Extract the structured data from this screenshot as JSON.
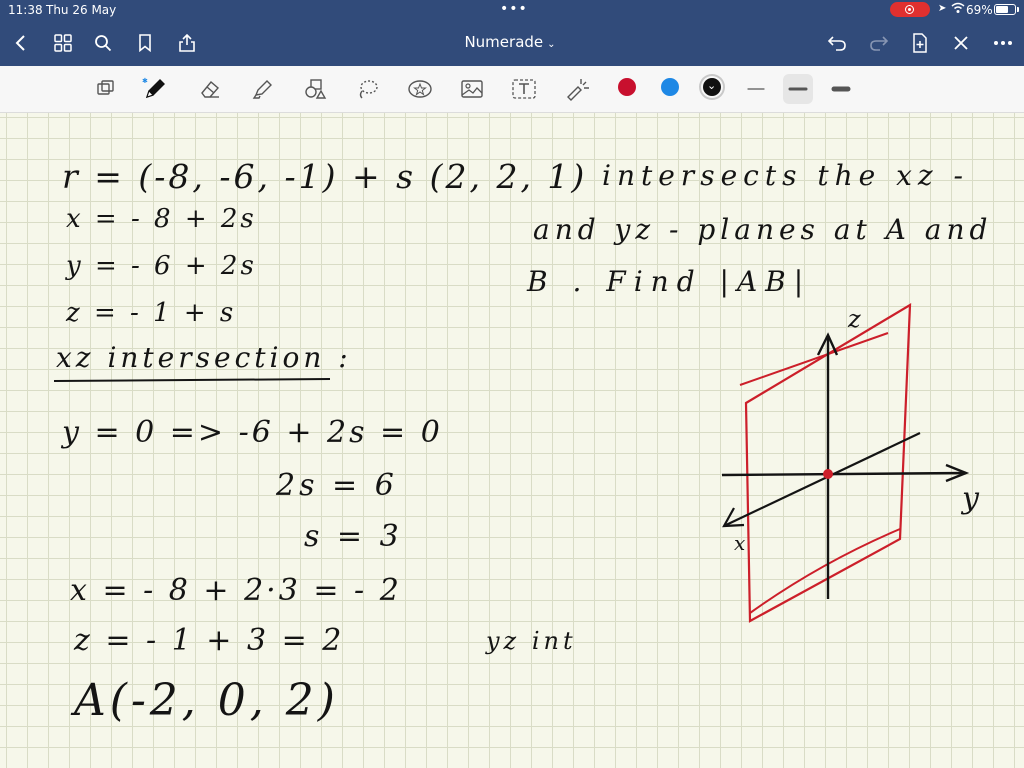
{
  "status_bar": {
    "time": "11:38",
    "date": "Thu 26 May",
    "battery": "69%",
    "battery_level": 0.69
  },
  "nav": {
    "title": "Numerade",
    "icons": [
      "back-chevron-icon",
      "grid-icon",
      "search-icon",
      "bookmark-icon",
      "share-icon",
      "undo-icon",
      "redo-icon",
      "add-page-icon",
      "close-icon",
      "more-icon"
    ]
  },
  "toolbar": {
    "tools": [
      "lasso-select-icon",
      "pen-icon",
      "eraser-icon",
      "highlighter-icon",
      "shapes-icon",
      "lasso-icon",
      "sticker-icon",
      "image-icon",
      "text-icon",
      "laser-pointer-icon"
    ],
    "colors": [
      "#c8102e",
      "#1e88e5",
      "#111111"
    ],
    "selected_color": "#111111",
    "stroke_widths": [
      "thin",
      "medium",
      "thick"
    ],
    "selected_stroke": "medium"
  },
  "notes": {
    "line1": "r = (-8, -6, -1) + s (2, 2, 1)",
    "line1_right": "intersects the xz -",
    "line2_right": "and yz - planes at A and",
    "line3_right": "B . Find |AB|",
    "x_eq": "x = - 8 + 2s",
    "y_eq": "y = - 6 + 2s",
    "z_eq": "z = - 1 + s",
    "xz_heading": "xz intersection :",
    "y_zero": "y = 0 => -6 + 2s = 0",
    "two_s": "2s = 6",
    "s_val": "s = 3",
    "x_val": "x = - 8 + 2·3 = - 2",
    "z_val": "z = - 1 + 3 = 2",
    "yz_int": "yz int",
    "point_a": "A(-2, 0, 2)",
    "axis_z": "z",
    "axis_y": "y",
    "axis_x": "x"
  }
}
